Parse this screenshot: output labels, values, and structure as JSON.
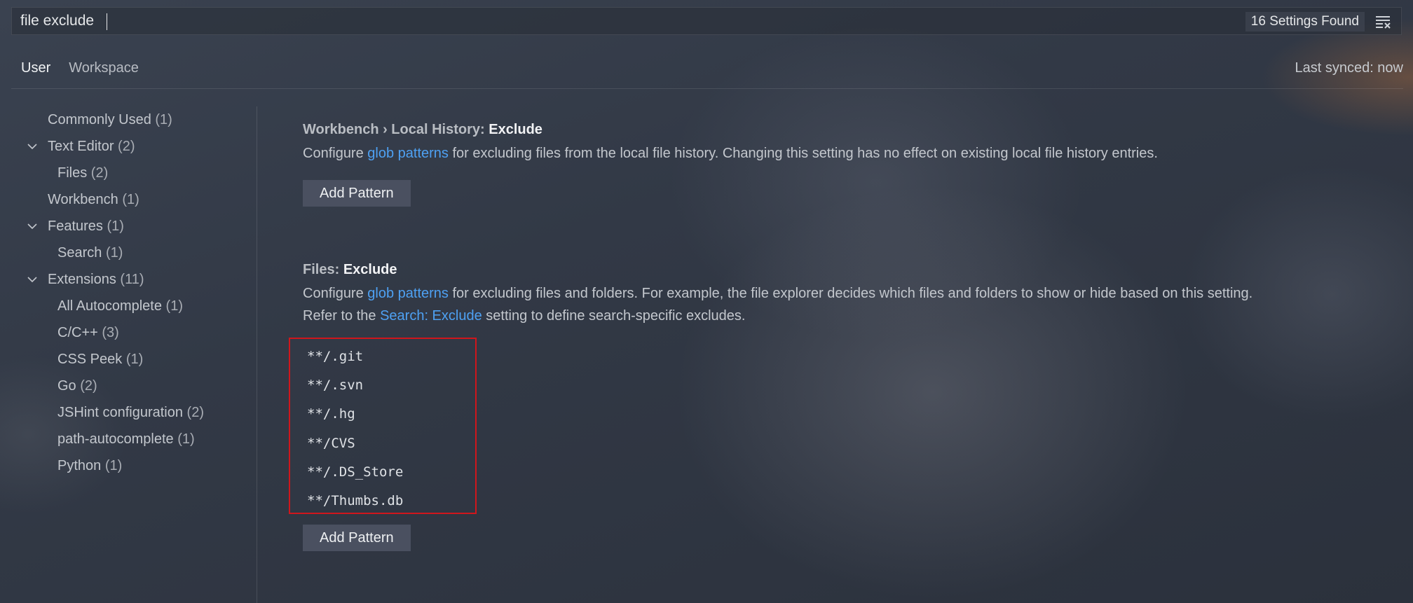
{
  "search": {
    "value": "file exclude",
    "result_count": "16 Settings Found"
  },
  "tabs": {
    "user": "User",
    "workspace": "Workspace"
  },
  "sync": {
    "label": "Last synced: now"
  },
  "toc": {
    "items": [
      {
        "label": "Commonly Used",
        "count": "(1)"
      },
      {
        "label": "Text Editor",
        "count": "(2)"
      },
      {
        "label": "Files",
        "count": "(2)"
      },
      {
        "label": "Workbench",
        "count": "(1)"
      },
      {
        "label": "Features",
        "count": "(1)"
      },
      {
        "label": "Search",
        "count": "(1)"
      },
      {
        "label": "Extensions",
        "count": "(11)"
      },
      {
        "label": "All Autocomplete",
        "count": "(1)"
      },
      {
        "label": "C/C++",
        "count": "(3)"
      },
      {
        "label": "CSS Peek",
        "count": "(1)"
      },
      {
        "label": "Go",
        "count": "(2)"
      },
      {
        "label": "JSHint configuration",
        "count": "(2)"
      },
      {
        "label": "path-autocomplete",
        "count": "(1)"
      },
      {
        "label": "Python",
        "count": "(1)"
      }
    ]
  },
  "settings": {
    "local_history": {
      "category": "Workbench › Local History:",
      "name": "Exclude",
      "desc_pre": "Configure",
      "desc_link": "glob patterns",
      "desc_post": "for excluding files from the local file history. Changing this setting has no effect on existing local file history entries.",
      "button": "Add Pattern"
    },
    "files_exclude": {
      "category": "Files:",
      "name": "Exclude",
      "desc_pre": "Configure",
      "desc_link": "glob patterns",
      "desc_post": "for excluding files and folders. For example, the file explorer decides which files and folders to show or hide based on this setting.",
      "desc2_pre": "Refer to the",
      "desc2_link": "Search: Exclude",
      "desc2_post": "setting to define search-specific excludes.",
      "patterns": [
        "**/.git",
        "**/.svn",
        "**/.hg",
        "**/CVS",
        "**/.DS_Store",
        "**/Thumbs.db"
      ],
      "button": "Add Pattern"
    }
  },
  "colors": {
    "link": "#4ea1f3",
    "highlight_border": "#d0161c",
    "button_bg": "#4a5060"
  }
}
